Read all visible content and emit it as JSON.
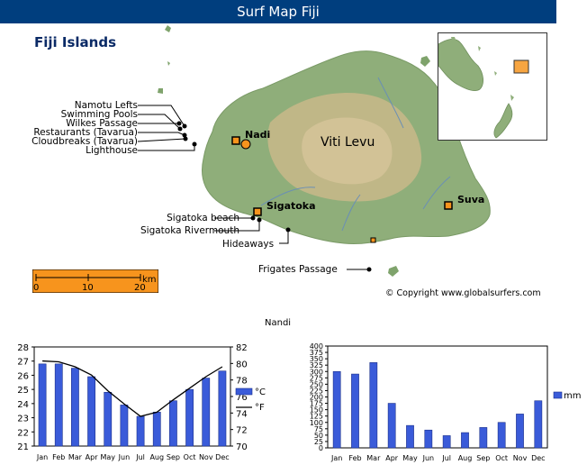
{
  "header": {
    "title": "Surf Map Fiji"
  },
  "map": {
    "region_title": "Fiji Islands",
    "island_name": "Viti Levu",
    "cities": [
      {
        "name": "Nadi"
      },
      {
        "name": "Sigatoka"
      },
      {
        "name": "Suva"
      }
    ],
    "left_labels": [
      "Namotu Lefts",
      "Swimming Pools",
      "Wilkes Passage",
      "Restaurants (Tavarua)",
      "Cloudbreaks (Tavarua)",
      "Lighthouse"
    ],
    "south_labels": {
      "sigatoka_beach": "Sigatoka beach",
      "sigatoka_rivermouth": "Sigatoka Rivermouth",
      "hideaways": "Hideaways",
      "frigates": "Frigates Passage"
    },
    "copyright": "© Copyright www.globalsurfers.com",
    "scale": {
      "unit": "km",
      "ticks": [
        "0",
        "10",
        "20"
      ]
    },
    "colors": {
      "land": "#8fae7a",
      "highland": "#c9b98a",
      "scale_fill": "#f7941d",
      "inset_marker": "#f7a541"
    }
  },
  "charts_caption": "Nandi",
  "chart_data": [
    {
      "type": "bar",
      "categories": [
        "Jan",
        "Feb",
        "Mar",
        "Apr",
        "May",
        "Jun",
        "Jul",
        "Aug",
        "Sep",
        "Oct",
        "Nov",
        "Dec"
      ],
      "series": [
        {
          "name": "°C",
          "values": [
            26.8,
            26.8,
            26.5,
            25.9,
            24.8,
            23.9,
            23.1,
            23.4,
            24.2,
            25.0,
            25.8,
            26.3
          ]
        },
        {
          "name": "°F",
          "values": [
            80.3,
            80.2,
            79.6,
            78.6,
            76.7,
            75.1,
            73.6,
            74.1,
            75.6,
            77.0,
            78.4,
            79.6
          ]
        }
      ],
      "ylim": [
        21,
        28
      ],
      "y2lim": [
        70,
        82
      ],
      "yticks": [
        21,
        22,
        23,
        24,
        25,
        26,
        27,
        28
      ],
      "y2ticks": [
        70,
        72,
        74,
        76,
        78,
        80,
        82
      ],
      "legend": "right",
      "colors": {
        "bar": "#3a5bd9",
        "line": "#000000"
      }
    },
    {
      "type": "bar",
      "categories": [
        "Jan",
        "Feb",
        "Mar",
        "Apr",
        "May",
        "Jun",
        "Jul",
        "Aug",
        "Sep",
        "Oct",
        "Nov",
        "Dec"
      ],
      "series": [
        {
          "name": "mm",
          "values": [
            300,
            290,
            335,
            175,
            88,
            70,
            48,
            60,
            80,
            100,
            133,
            185
          ]
        }
      ],
      "ylim": [
        0,
        400
      ],
      "yticks": [
        0,
        25,
        50,
        75,
        100,
        125,
        150,
        175,
        200,
        225,
        250,
        275,
        300,
        325,
        350,
        375,
        400
      ],
      "legend": "right",
      "colors": {
        "bar": "#3a5bd9"
      }
    }
  ]
}
